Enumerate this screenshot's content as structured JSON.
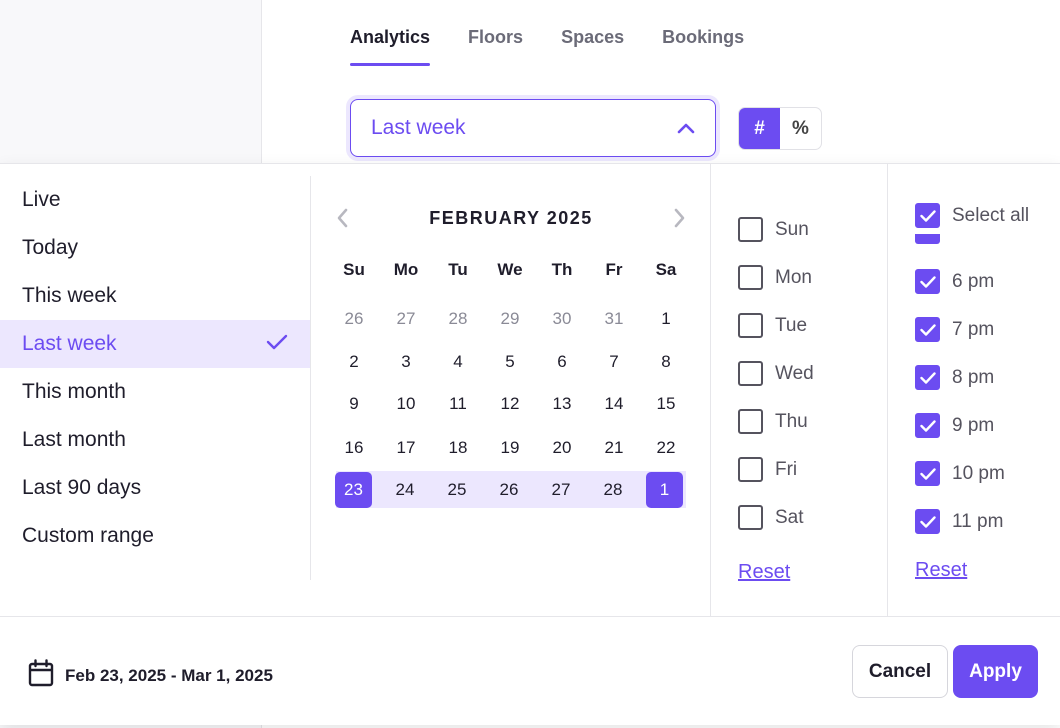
{
  "tabs": [
    {
      "label": "Analytics",
      "active": true
    },
    {
      "label": "Floors",
      "active": false
    },
    {
      "label": "Spaces",
      "active": false
    },
    {
      "label": "Bookings",
      "active": false
    }
  ],
  "range_select": {
    "value": "Last week",
    "icon": "chevron-up-icon"
  },
  "display_toggle": {
    "count_label": "#",
    "percent_label": "%",
    "selected": "#"
  },
  "presets": [
    {
      "label": "Live"
    },
    {
      "label": "Today"
    },
    {
      "label": "This week"
    },
    {
      "label": "Last week",
      "selected": true
    },
    {
      "label": "This month"
    },
    {
      "label": "Last month"
    },
    {
      "label": "Last 90 days"
    },
    {
      "label": "Custom range"
    }
  ],
  "calendar": {
    "title": "FEBRUARY 2025",
    "weekdays": [
      "Su",
      "Mo",
      "Tu",
      "We",
      "Th",
      "Fr",
      "Sa"
    ],
    "weeks": [
      [
        "26",
        "27",
        "28",
        "29",
        "30",
        "31",
        "1"
      ],
      [
        "2",
        "3",
        "4",
        "5",
        "6",
        "7",
        "8"
      ],
      [
        "9",
        "10",
        "11",
        "12",
        "13",
        "14",
        "15"
      ],
      [
        "16",
        "17",
        "18",
        "19",
        "20",
        "21",
        "22"
      ],
      [
        "23",
        "24",
        "25",
        "26",
        "27",
        "28",
        "1"
      ]
    ],
    "range_start": "23",
    "range_end": "1"
  },
  "weekday_filter": {
    "items": [
      {
        "label": "Sun",
        "checked": false
      },
      {
        "label": "Mon",
        "checked": false
      },
      {
        "label": "Tue",
        "checked": false
      },
      {
        "label": "Wed",
        "checked": false
      },
      {
        "label": "Thu",
        "checked": false
      },
      {
        "label": "Fri",
        "checked": false
      },
      {
        "label": "Sat",
        "checked": false
      }
    ],
    "reset_label": "Reset"
  },
  "hour_filter": {
    "select_all_label": "Select all",
    "items": [
      {
        "label": "6 pm",
        "checked": true
      },
      {
        "label": "7 pm",
        "checked": true
      },
      {
        "label": "8 pm",
        "checked": true
      },
      {
        "label": "9 pm",
        "checked": true
      },
      {
        "label": "10 pm",
        "checked": true
      },
      {
        "label": "11 pm",
        "checked": true
      }
    ],
    "reset_label": "Reset"
  },
  "footer": {
    "date_range": "Feb 23, 2025 - Mar 1, 2025",
    "cancel_label": "Cancel",
    "apply_label": "Apply"
  },
  "colors": {
    "accent": "#6c4cf1",
    "accent_light": "#ece7fe"
  }
}
